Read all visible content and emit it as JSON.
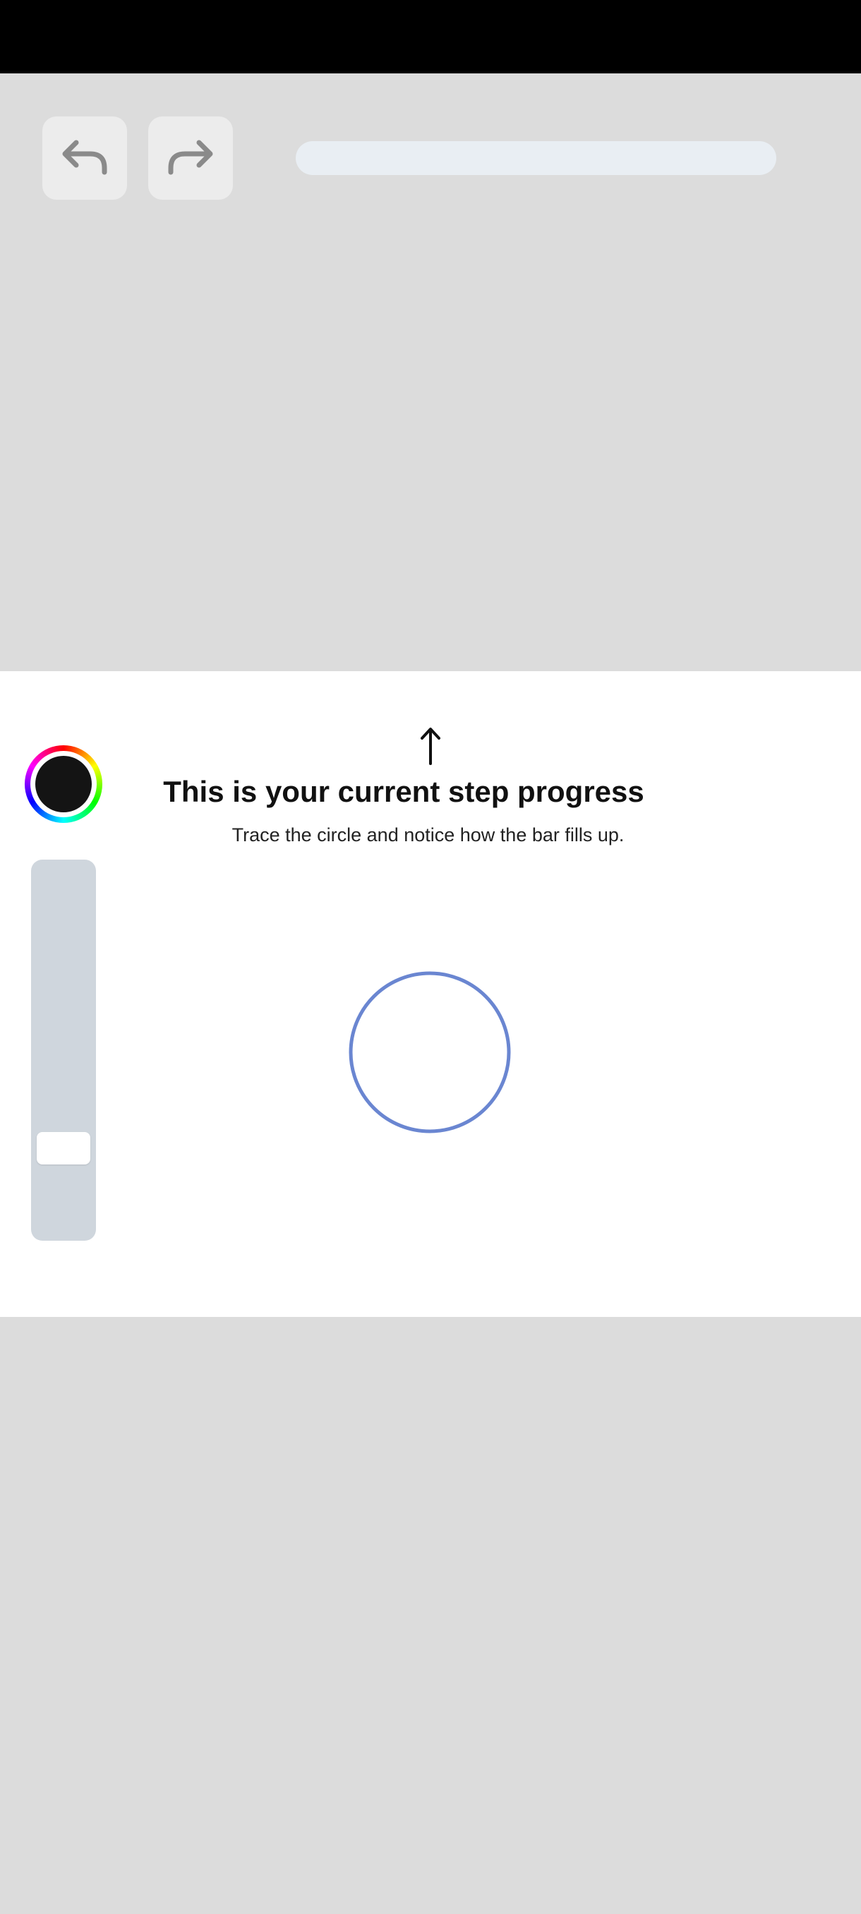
{
  "toolbar": {
    "undo_icon": "undo-arrow-icon",
    "redo_icon": "redo-arrow-icon",
    "step_progress": 0
  },
  "side_controls": {
    "color_picker_icon": "color-wheel-icon",
    "selected_color": "#141414",
    "brush_size_level": 0.21
  },
  "tutorial": {
    "arrow_icon": "up-arrow-icon",
    "title": "This is your current step progress",
    "subtitle": "Trace the circle and notice how the bar fills up."
  },
  "colors": {
    "accent": "#6a86d1",
    "panel_bg": "#ffffff",
    "overlay_bg": "#dcdcdc",
    "progress_track": "#e9eef3",
    "slider_track": "#cfd6dd"
  }
}
